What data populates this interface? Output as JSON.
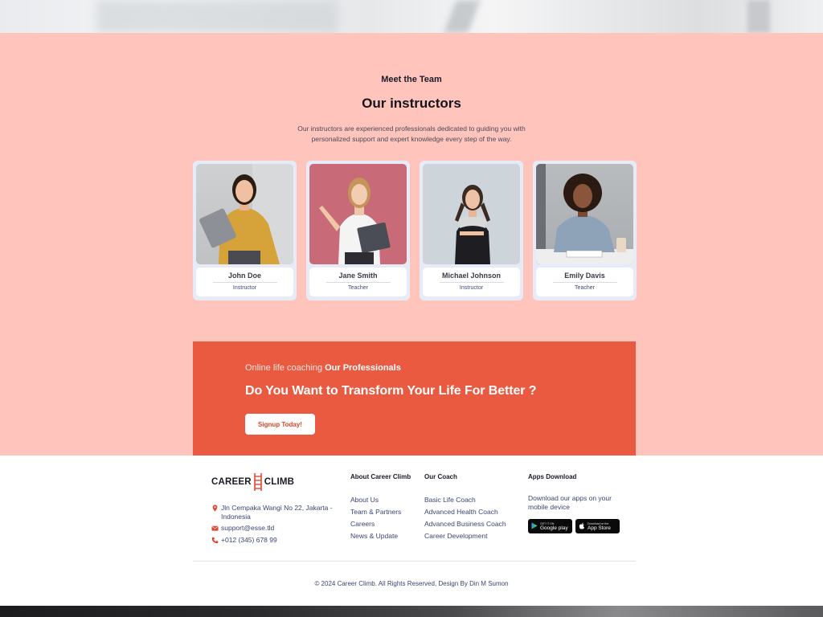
{
  "team": {
    "eyebrow": "Meet the Team",
    "heading": "Our instructors",
    "description": "Our instructors are experienced professionals dedicated to guiding you with personalized support and expert knowledge every step of the way.",
    "members": [
      {
        "name": "John Doe",
        "role": "Instructor"
      },
      {
        "name": "Jane Smith",
        "role": "Teacher"
      },
      {
        "name": "Michael Johnson",
        "role": "Instructor"
      },
      {
        "name": "Emily Davis",
        "role": "Teacher"
      }
    ]
  },
  "cta": {
    "kicker_plain": "Online life coaching",
    "kicker_bold": "Our Professionals",
    "title": "Do You Want to Transform Your Life For Better ?",
    "button": "Signup Today!"
  },
  "footer": {
    "logo_left": "CAREER",
    "logo_right": "CLIMB",
    "address": "Jln Cempaka Wangi No 22, Jakarta - Indonesia",
    "email": "support@esse.tld",
    "phone": "+012 (345) 678 99",
    "about": {
      "title": "About Career Climb",
      "links": [
        "About Us",
        "Team & Partners",
        "Careers",
        "News & Update"
      ]
    },
    "coach": {
      "title": "Our Coach",
      "links": [
        "Basic Life Coach",
        "Advanced Health Coach",
        "Advanced Business Coach",
        "Career Development"
      ]
    },
    "apps": {
      "title": "Apps Download",
      "text": "Download our apps on your mobile device",
      "google_small": "GET IT ON",
      "google_large": "Google play",
      "apple_small": "Download on the",
      "apple_large": "App Store"
    },
    "copyright": "© 2024 Career Climb. All Rights Reserved, Design By Din M Sumon"
  },
  "colors": {
    "section_bg": "#ffc4bc",
    "cta_bg": "#ea5a40",
    "card_bg": "#e6ebf7"
  }
}
